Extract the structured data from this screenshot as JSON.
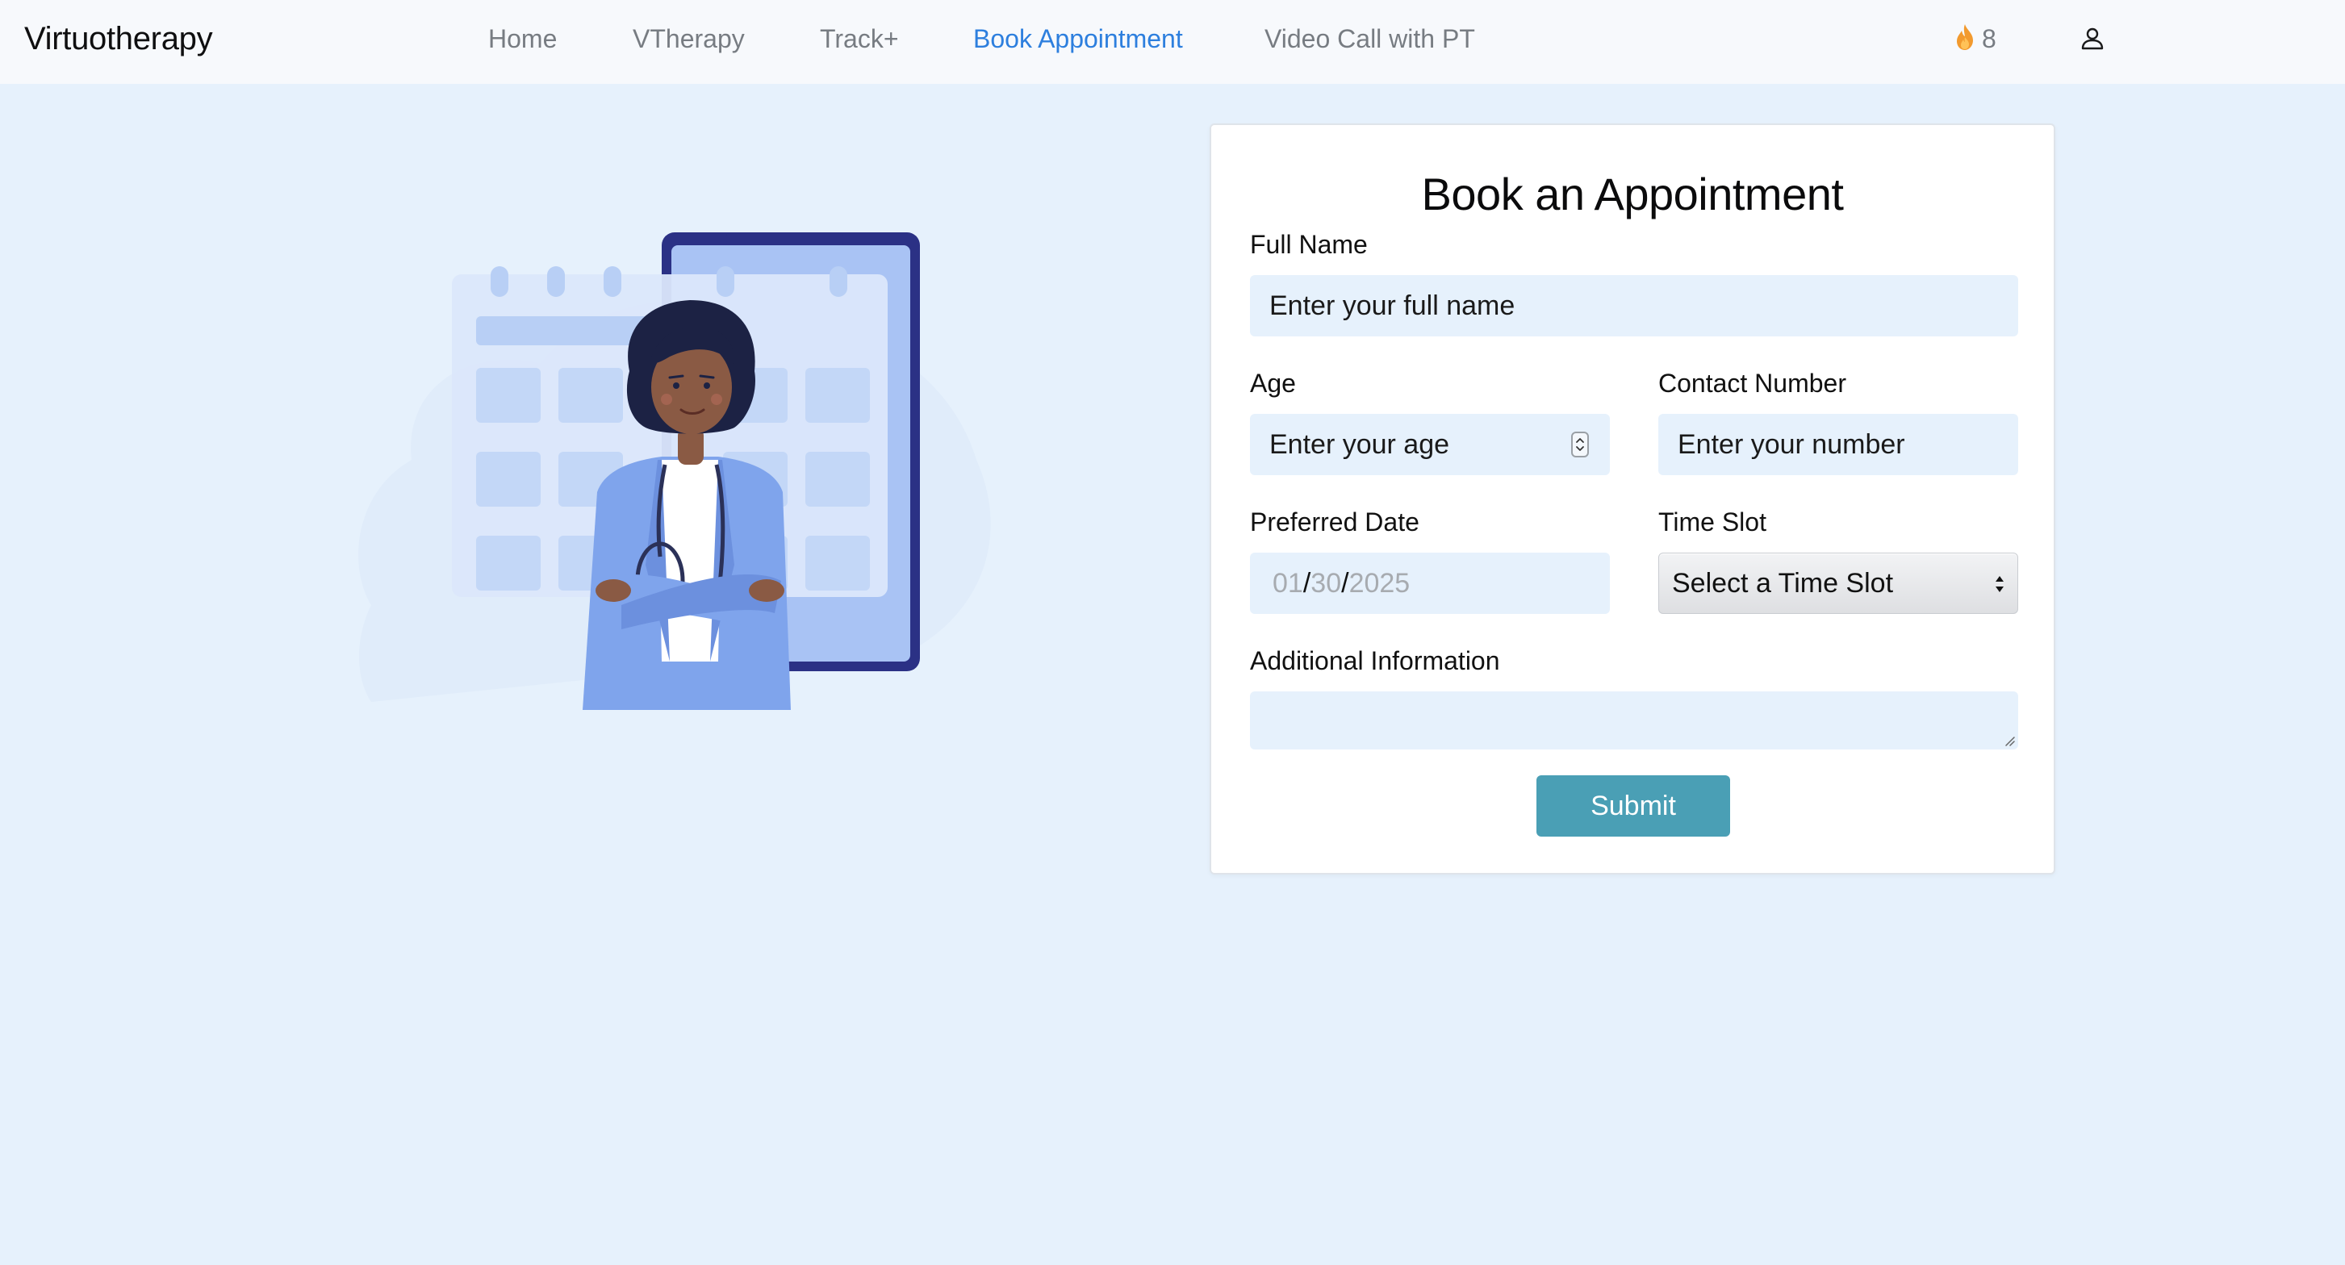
{
  "nav": {
    "brand": "Virtuotherapy",
    "links": [
      {
        "label": "Home",
        "active": false
      },
      {
        "label": "VTherapy",
        "active": false
      },
      {
        "label": "Track+",
        "active": false
      },
      {
        "label": "Book Appointment",
        "active": true
      },
      {
        "label": "Video Call with PT",
        "active": false
      }
    ],
    "streak_icon": "flame-icon",
    "streak_count": "8",
    "profile_icon": "user-icon"
  },
  "illustration": {
    "subject": "doctor-with-calendar-illustration"
  },
  "form": {
    "title": "Book an Appointment",
    "full_name": {
      "label": "Full Name",
      "placeholder": "Enter your full name"
    },
    "age": {
      "label": "Age",
      "placeholder": "Enter your age"
    },
    "contact": {
      "label": "Contact Number",
      "placeholder": "Enter your number"
    },
    "preferred_date": {
      "label": "Preferred Date",
      "month": "01",
      "day": "30",
      "year": "2025",
      "separator": "/"
    },
    "time_slot": {
      "label": "Time Slot",
      "selected": "Select a Time Slot"
    },
    "additional_info": {
      "label": "Additional Information",
      "value": ""
    },
    "submit_label": "Submit"
  },
  "colors": {
    "page_background": "#e6f1fc",
    "navbar_background": "#f7f9fc",
    "active_link": "#2d7fde",
    "nav_link": "#777c82",
    "submit_button": "#4a9fb5",
    "input_background": "#e6f1fc"
  }
}
